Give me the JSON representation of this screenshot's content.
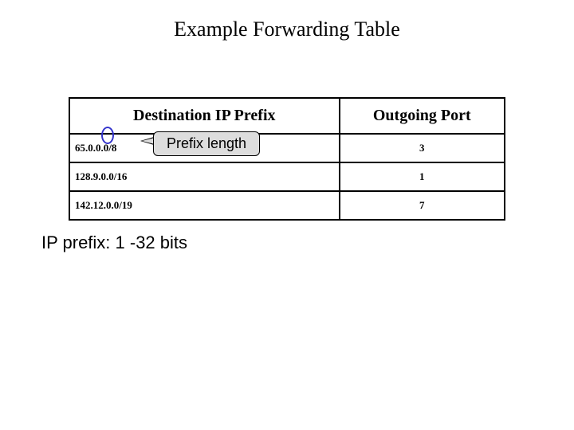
{
  "title": "Example Forwarding Table",
  "columns": {
    "prefix": "Destination IP Prefix",
    "port": "Outgoing Port"
  },
  "rows": [
    {
      "prefix": "65.0.0.0/8",
      "port": "3"
    },
    {
      "prefix": "128.9.0.0/16",
      "port": "1"
    },
    {
      "prefix": "142.12.0.0/19",
      "port": "7"
    }
  ],
  "callout": {
    "label": "Prefix length"
  },
  "footnote": "IP prefix: 1 -32 bits"
}
